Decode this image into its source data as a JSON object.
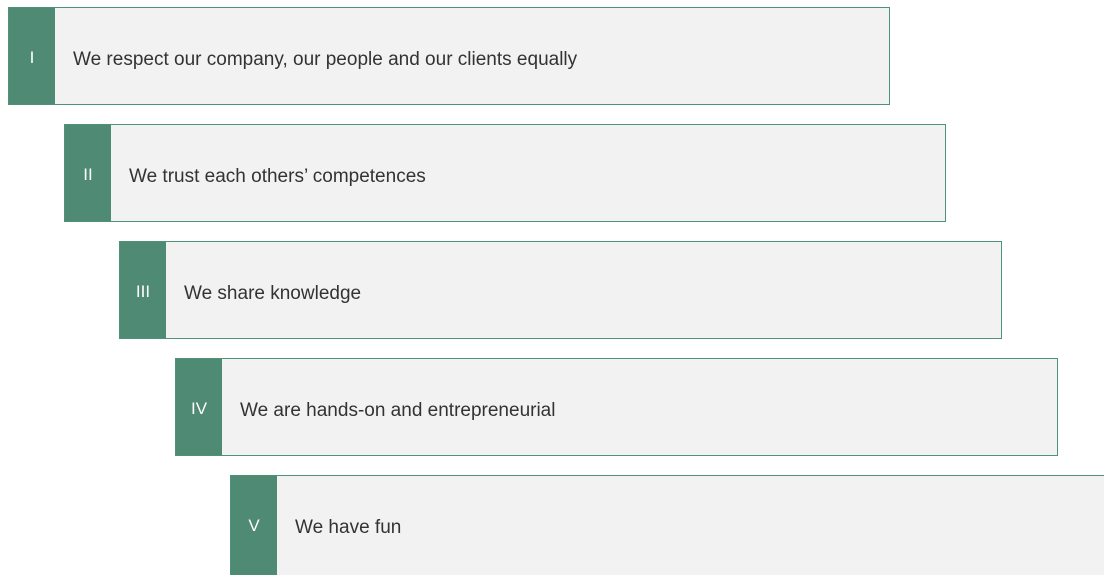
{
  "values": [
    {
      "numeral": "I",
      "text": "We respect our company, our people and our clients equally"
    },
    {
      "numeral": "II",
      "text": "We trust each others’ competences"
    },
    {
      "numeral": "III",
      "text": "We share knowledge"
    },
    {
      "numeral": "IV",
      "text": "We are hands-on and entrepreneurial"
    },
    {
      "numeral": "V",
      "text": "We have fun"
    }
  ],
  "colors": {
    "accent": "#4e8a74",
    "border": "#4e9278",
    "box_background": "#f2f2f2",
    "text": "#333333",
    "numeral_text": "#ffffff"
  }
}
